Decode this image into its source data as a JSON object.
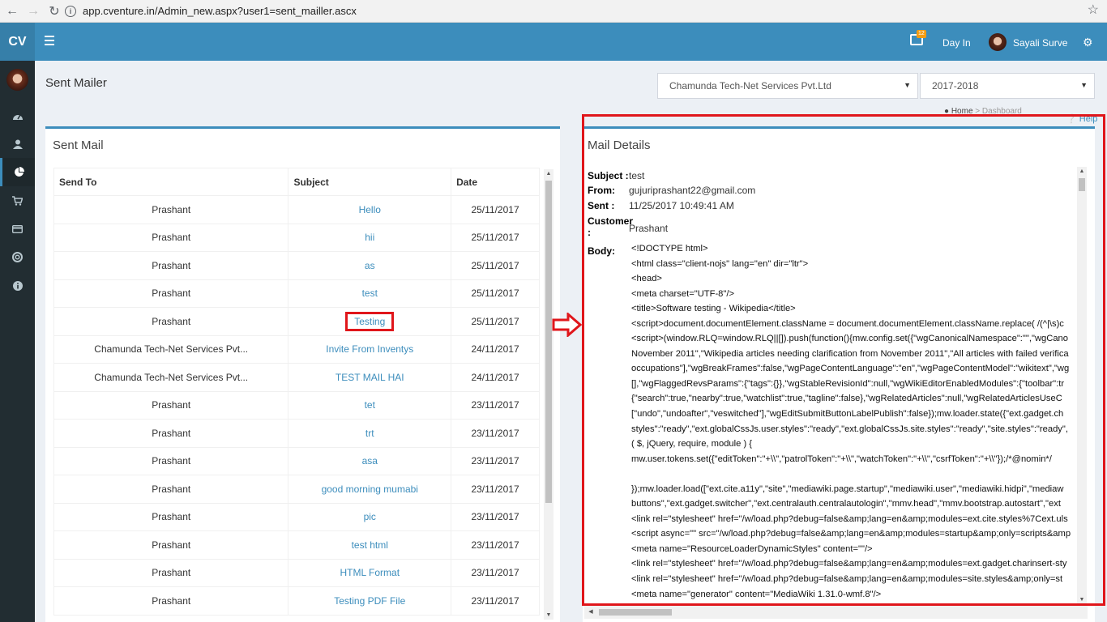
{
  "browser": {
    "url": "app.cventure.in/Admin_new.aspx?user1=sent_mailler.ascx"
  },
  "header": {
    "logo": "CV",
    "notification_count": "12",
    "day_in": "Day In",
    "user_name": "Sayali Surve"
  },
  "page": {
    "title": "Sent Mailer",
    "company_select": "Chamunda Tech-Net Services Pvt.Ltd",
    "year_select": "2017-2018",
    "breadcrumb_home": "Home",
    "breadcrumb_current": "Dashboard",
    "help": "Help"
  },
  "sent_mail": {
    "title": "Sent Mail",
    "columns": [
      "Send To",
      "Subject",
      "Date"
    ],
    "rows": [
      {
        "to": "Prashant",
        "subject": "Hello",
        "date": "25/11/2017"
      },
      {
        "to": "Prashant",
        "subject": "hii",
        "date": "25/11/2017"
      },
      {
        "to": "Prashant",
        "subject": "as",
        "date": "25/11/2017"
      },
      {
        "to": "Prashant",
        "subject": "test",
        "date": "25/11/2017"
      },
      {
        "to": "Prashant",
        "subject": "Testing",
        "date": "25/11/2017"
      },
      {
        "to": "Chamunda Tech-Net Services Pvt...",
        "subject": "Invite From Inventys",
        "date": "24/11/2017"
      },
      {
        "to": "Chamunda Tech-Net Services Pvt...",
        "subject": "TEST MAIL HAI",
        "date": "24/11/2017"
      },
      {
        "to": "Prashant",
        "subject": "tet",
        "date": "23/11/2017"
      },
      {
        "to": "Prashant",
        "subject": "trt",
        "date": "23/11/2017"
      },
      {
        "to": "Prashant",
        "subject": "asa",
        "date": "23/11/2017"
      },
      {
        "to": "Prashant",
        "subject": "good morning mumabi",
        "date": "23/11/2017"
      },
      {
        "to": "Prashant",
        "subject": "pic",
        "date": "23/11/2017"
      },
      {
        "to": "Prashant",
        "subject": "test html",
        "date": "23/11/2017"
      },
      {
        "to": "Prashant",
        "subject": "HTML Format",
        "date": "23/11/2017"
      },
      {
        "to": "Prashant",
        "subject": "Testing PDF File",
        "date": "23/11/2017"
      }
    ]
  },
  "mail_details": {
    "title": "Mail Details",
    "subject_label": "Subject :",
    "subject": "test",
    "from_label": "From:",
    "from": "gujuriprashant22@gmail.com",
    "sent_label": "Sent :",
    "sent": "11/25/2017 10:49:41 AM",
    "customer_label": "Customer :",
    "customer": "Prashant",
    "body_label": "Body:",
    "body_lines": [
      "<!DOCTYPE html>",
      "<html class=\"client-nojs\" lang=\"en\" dir=\"ltr\">",
      "<head>",
      "<meta charset=\"UTF-8\"/>",
      "<title>Software testing - Wikipedia</title>",
      "<script>document.documentElement.className = document.documentElement.className.replace( /(^|\\s)c",
      "<script>(window.RLQ=window.RLQ||[]).push(function(){mw.config.set({\"wgCanonicalNamespace\":\"\",\"wgCano",
      "November 2011\",\"Wikipedia articles needing clarification from November 2011\",\"All articles with failed verifica",
      "occupations\"],\"wgBreakFrames\":false,\"wgPageContentLanguage\":\"en\",\"wgPageContentModel\":\"wikitext\",\"wg",
      "[],\"wgFlaggedRevsParams\":{\"tags\":{}},\"wgStableRevisionId\":null,\"wgWikiEditorEnabledModules\":{\"toolbar\":tr",
      "{\"search\":true,\"nearby\":true,\"watchlist\":true,\"tagline\":false},\"wgRelatedArticles\":null,\"wgRelatedArticlesUseC",
      "[\"undo\",\"undoafter\",\"veswitched\"],\"wgEditSubmitButtonLabelPublish\":false});mw.loader.state({\"ext.gadget.ch",
      "styles\":\"ready\",\"ext.globalCssJs.user.styles\":\"ready\",\"ext.globalCssJs.site.styles\":\"ready\",\"site.styles\":\"ready\",",
      "( $, jQuery, require, module ) {",
      "mw.user.tokens.set({\"editToken\":\"+\\\\\",\"patrolToken\":\"+\\\\\",\"watchToken\":\"+\\\\\",\"csrfToken\":\"+\\\\\"});/*@nomin*/",
      "",
      "});mw.loader.load([\"ext.cite.a11y\",\"site\",\"mediawiki.page.startup\",\"mediawiki.user\",\"mediawiki.hidpi\",\"mediaw",
      "buttons\",\"ext.gadget.switcher\",\"ext.centralauth.centralautologin\",\"mmv.head\",\"mmv.bootstrap.autostart\",\"ext",
      "<link rel=\"stylesheet\" href=\"/w/load.php?debug=false&amp;lang=en&amp;modules=ext.cite.styles%7Cext.uls",
      "<script async=\"\" src=\"/w/load.php?debug=false&amp;lang=en&amp;modules=startup&amp;only=scripts&amp",
      "<meta name=\"ResourceLoaderDynamicStyles\" content=\"\"/>",
      "<link rel=\"stylesheet\" href=\"/w/load.php?debug=false&amp;lang=en&amp;modules=ext.gadget.charinsert-sty",
      "<link rel=\"stylesheet\" href=\"/w/load.php?debug=false&amp;lang=en&amp;modules=site.styles&amp;only=st",
      "<meta name=\"generator\" content=\"MediaWiki 1.31.0-wmf.8\"/>"
    ]
  },
  "icons": {
    "back": "back-icon",
    "forward": "forward-icon",
    "reload": "reload-icon",
    "star": "star-icon",
    "menu": "menu-icon",
    "notification": "notification-icon",
    "settings": "gears-icon",
    "sidebar": [
      "dashboard-icon",
      "user-icon",
      "pie-chart-icon",
      "cart-icon",
      "credit-card-icon",
      "support-icon",
      "info-icon"
    ]
  },
  "colors": {
    "header_blue": "#3c8dbc",
    "sidebar_dark": "#222d32",
    "highlight_red": "#e0161b",
    "link_blue": "#3c8dbc"
  }
}
